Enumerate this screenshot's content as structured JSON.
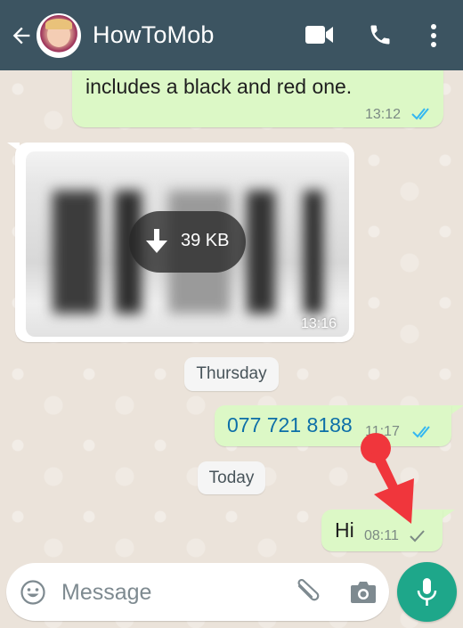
{
  "header": {
    "contact_name": "HowToMob",
    "icons": [
      "back-arrow-icon",
      "avatar",
      "video-call-icon",
      "phone-icon",
      "more-vertical-icon"
    ]
  },
  "messages": [
    {
      "type": "outgoing_text",
      "text": "includes a black and red one.",
      "time": "13:12",
      "status": "read"
    },
    {
      "type": "incoming_image",
      "download_label": "39 KB",
      "time": "13:16"
    },
    {
      "type": "date_divider",
      "label": "Thursday"
    },
    {
      "type": "outgoing_text",
      "text": "077 721 8188",
      "time": "11:17",
      "status": "read",
      "is_phone_link": true
    },
    {
      "type": "date_divider",
      "label": "Today"
    },
    {
      "type": "outgoing_text",
      "text": "Hi",
      "time": "08:11",
      "status": "sent"
    }
  ],
  "annotation": {
    "type": "arrow",
    "color": "#f0363c",
    "points_to": "single-tick-08:11"
  },
  "composer": {
    "placeholder": "Message",
    "value": ""
  },
  "colors": {
    "header_bg": "#3c5461",
    "outgoing_bubble": "#dcf8c6",
    "read_tick": "#34b7f1",
    "accent_green": "#1ea78a",
    "chat_bg": "#ebe3da"
  }
}
